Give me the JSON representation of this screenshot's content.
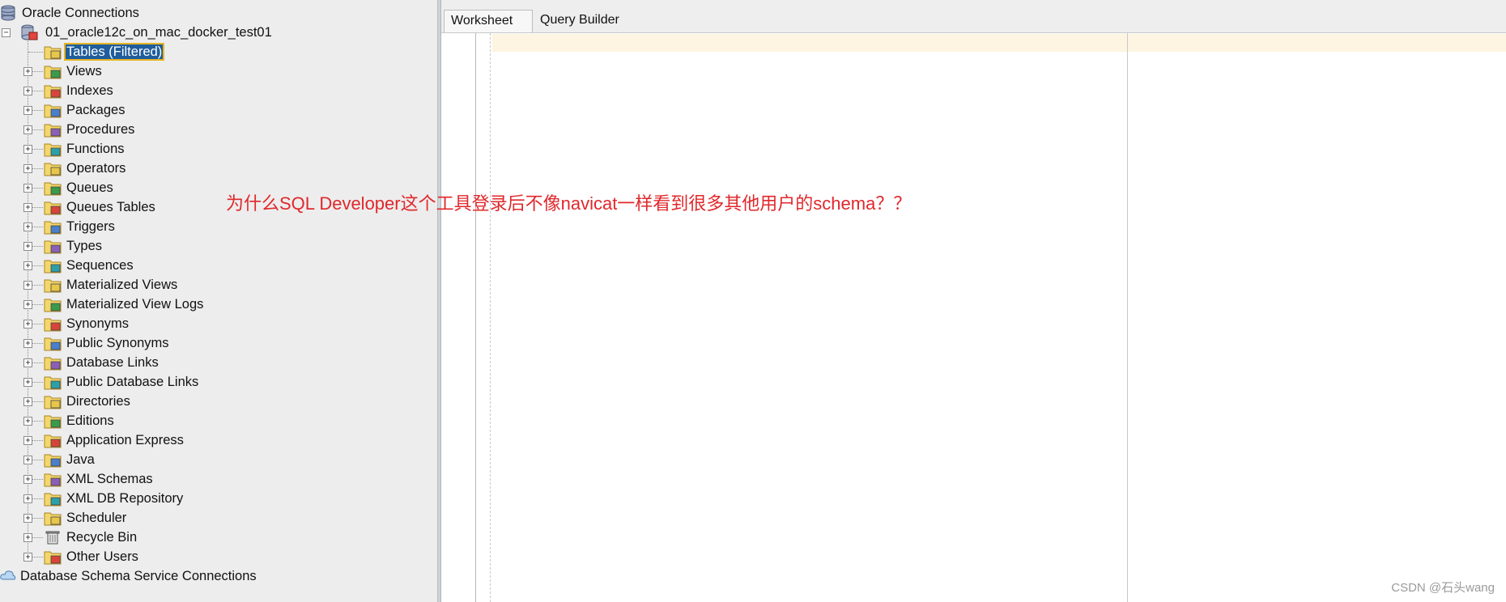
{
  "connections_root": {
    "label": "Oracle Connections"
  },
  "connection": {
    "label": "01_oracle12c_on_mac_docker_test01"
  },
  "tree_items": [
    {
      "label": "Tables (Filtered)",
      "icon": "tables-folder-icon",
      "selected": true
    },
    {
      "label": "Views",
      "icon": "views-folder-icon"
    },
    {
      "label": "Indexes",
      "icon": "indexes-folder-icon"
    },
    {
      "label": "Packages",
      "icon": "packages-folder-icon"
    },
    {
      "label": "Procedures",
      "icon": "procedures-folder-icon"
    },
    {
      "label": "Functions",
      "icon": "functions-folder-icon"
    },
    {
      "label": "Operators",
      "icon": "operators-folder-icon"
    },
    {
      "label": "Queues",
      "icon": "queues-folder-icon"
    },
    {
      "label": "Queues Tables",
      "icon": "queues-tables-folder-icon"
    },
    {
      "label": "Triggers",
      "icon": "triggers-folder-icon"
    },
    {
      "label": "Types",
      "icon": "types-folder-icon"
    },
    {
      "label": "Sequences",
      "icon": "sequences-folder-icon"
    },
    {
      "label": "Materialized Views",
      "icon": "materialized-views-folder-icon"
    },
    {
      "label": "Materialized View Logs",
      "icon": "materialized-view-logs-folder-icon"
    },
    {
      "label": "Synonyms",
      "icon": "synonyms-folder-icon"
    },
    {
      "label": "Public Synonyms",
      "icon": "public-synonyms-folder-icon"
    },
    {
      "label": "Database Links",
      "icon": "database-links-folder-icon"
    },
    {
      "label": "Public Database Links",
      "icon": "public-database-links-folder-icon"
    },
    {
      "label": "Directories",
      "icon": "directories-folder-icon"
    },
    {
      "label": "Editions",
      "icon": "editions-folder-icon"
    },
    {
      "label": "Application Express",
      "icon": "application-express-folder-icon"
    },
    {
      "label": "Java",
      "icon": "java-folder-icon"
    },
    {
      "label": "XML Schemas",
      "icon": "xml-schemas-folder-icon"
    },
    {
      "label": "XML DB Repository",
      "icon": "xml-db-repository-folder-icon"
    },
    {
      "label": "Scheduler",
      "icon": "scheduler-folder-icon"
    },
    {
      "label": "Recycle Bin",
      "icon": "recycle-bin-icon"
    },
    {
      "label": "Other Users",
      "icon": "other-users-folder-icon"
    }
  ],
  "schema_service": {
    "label": "Database Schema Service Connections"
  },
  "tabs": [
    {
      "label": "Worksheet",
      "active": true
    },
    {
      "label": "Query Builder",
      "active": false
    }
  ],
  "annotation": "为什么SQL  Developer这个工具登录后不像navicat一样看到很多其他用户的schema？？",
  "watermark": "CSDN @石头wang",
  "colors": {
    "selection": "#1f5d9c",
    "annotation": "#e0282c",
    "current_line": "#fdf5e2"
  }
}
